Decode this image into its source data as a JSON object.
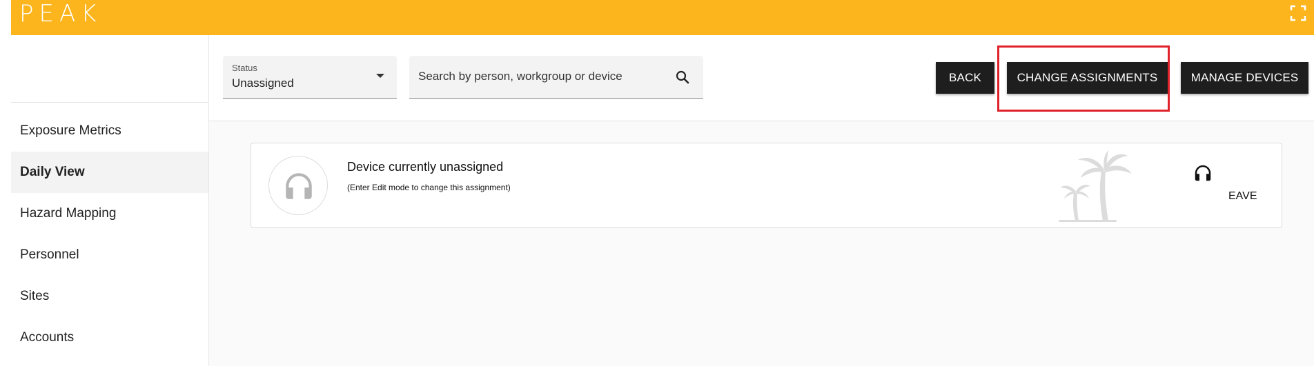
{
  "app": {
    "logo": "PEAK",
    "brand_color": "#fdb51d",
    "fullscreen_icon": "fullscreen-icon"
  },
  "sidebar": {
    "items": [
      {
        "label": "Exposure Metrics",
        "active": false
      },
      {
        "label": "Daily View",
        "active": true
      },
      {
        "label": "Hazard Mapping",
        "active": false
      },
      {
        "label": "Personnel",
        "active": false
      },
      {
        "label": "Sites",
        "active": false
      },
      {
        "label": "Accounts",
        "active": false
      }
    ]
  },
  "toolbar": {
    "status": {
      "label": "Status",
      "value": "Unassigned"
    },
    "search": {
      "placeholder": "Search by person, workgroup or device",
      "value": ""
    },
    "back_label": "BACK",
    "change_label": "CHANGE ASSIGNMENTS",
    "manage_label": "MANAGE DEVICES",
    "highlight_color": "#e0212b"
  },
  "device_card": {
    "title": "Device currently unassigned",
    "subtitle": "(Enter Edit mode to change this assignment)",
    "device_label": "EAVE",
    "icons": [
      "headphones-icon",
      "palm-tree-icon",
      "headphones-small-icon"
    ]
  }
}
